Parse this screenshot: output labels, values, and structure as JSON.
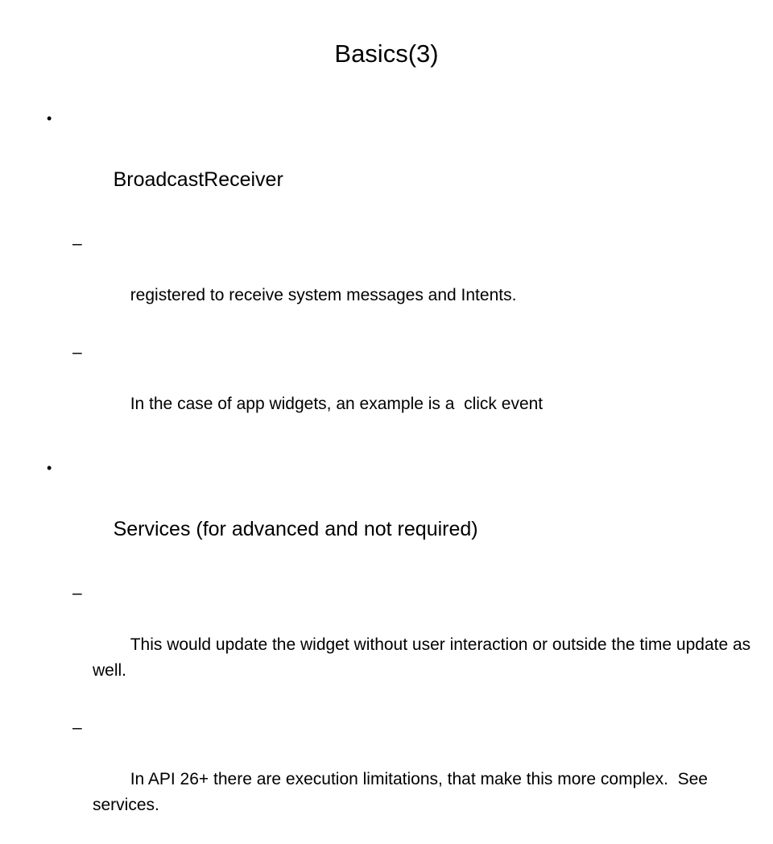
{
  "slide": {
    "title": "Basics(3)",
    "background_color": "#ffffff",
    "text_color": "#000000",
    "bullet_glyph": "•",
    "dash_glyph": "–",
    "groups": [
      {
        "heading": "BroadcastReceiver",
        "sub_items": [
          "registered to receive system messages and Intents.",
          "In the case of app widgets, an example is a  click event"
        ]
      },
      {
        "heading": "Services (for advanced and not required)",
        "sub_items": [
          "This would update the widget without user interaction or outside the time update as well.",
          "In API 26+ there are execution limitations, that make this more complex.  See services."
        ]
      }
    ]
  }
}
